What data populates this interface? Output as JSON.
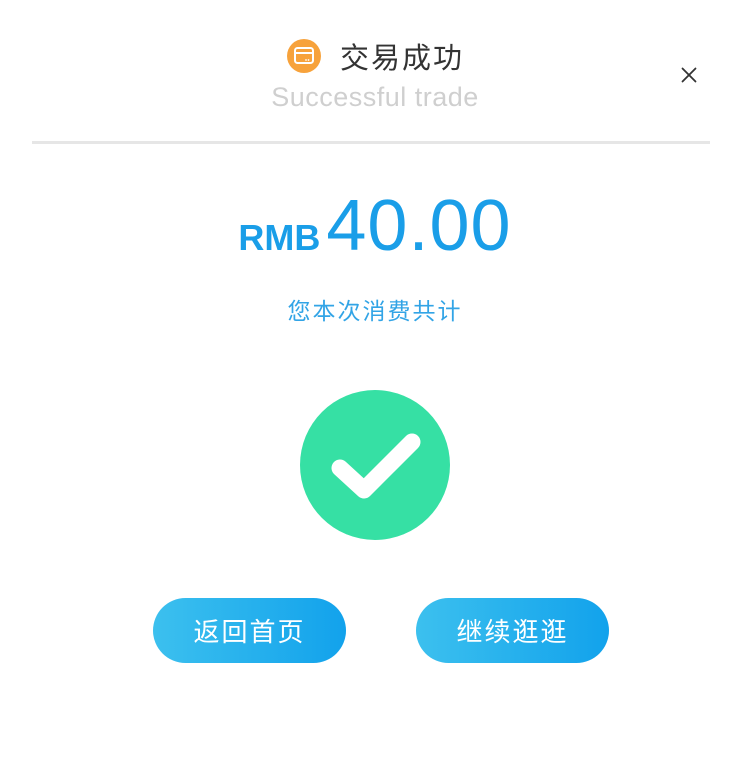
{
  "header": {
    "title_cn": "交易成功",
    "title_en": "Successful trade",
    "icon": "wallet-icon",
    "close_icon": "close-icon"
  },
  "payment": {
    "currency": "RMB",
    "amount": "40.00",
    "label": "您本次消费共计"
  },
  "status": {
    "icon": "checkmark-circle-icon"
  },
  "actions": {
    "home_label": "返回首页",
    "continue_label": "继续逛逛"
  },
  "colors": {
    "accent": "#1a9ee8",
    "success": "#36e0a4",
    "wallet": "#f7a23b",
    "button_gradient_start": "#3cc0ee",
    "button_gradient_end": "#12a2ec"
  }
}
